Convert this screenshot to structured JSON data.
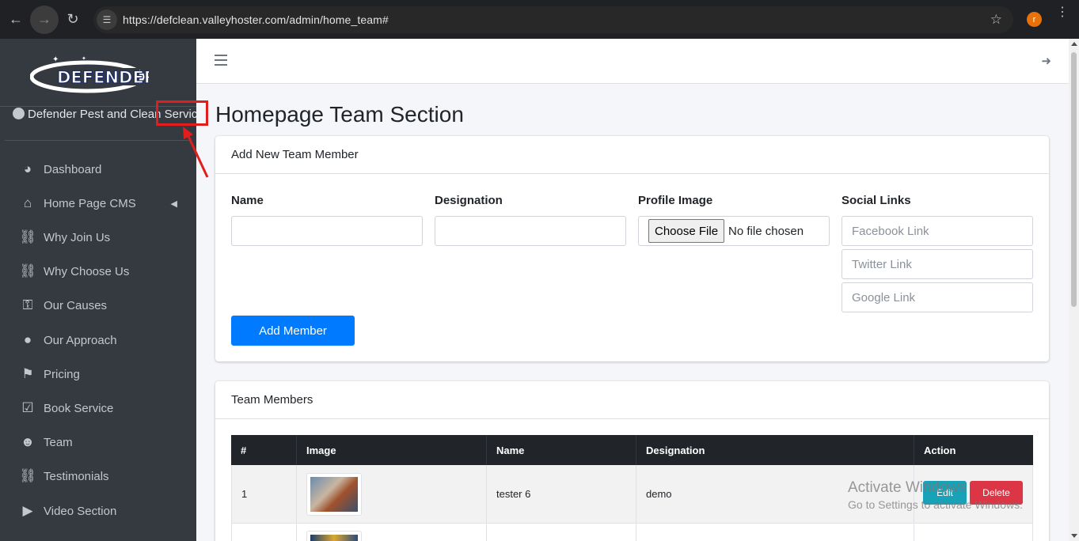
{
  "browser": {
    "url": "https://defclean.valleyhoster.com/admin/home_team#",
    "profile_initial": "r"
  },
  "sidebar": {
    "logo_text": "DEFENDER",
    "user_name": "Defender Pest and Clean Servic",
    "items": [
      {
        "label": "Dashboard",
        "icon": "tachometer-icon"
      },
      {
        "label": "Home Page CMS",
        "icon": "home-icon"
      },
      {
        "label": "Why Join Us",
        "icon": "comments-icon"
      },
      {
        "label": "Why Choose Us",
        "icon": "comments-icon"
      },
      {
        "label": "Our Causes",
        "icon": "key-icon"
      },
      {
        "label": "Our Approach",
        "icon": "lightbulb-icon"
      },
      {
        "label": "Pricing",
        "icon": "tags-icon"
      },
      {
        "label": "Book Service",
        "icon": "calendar-check-icon"
      },
      {
        "label": "Team",
        "icon": "users-icon"
      },
      {
        "label": "Testimonials",
        "icon": "comments-icon"
      },
      {
        "label": "Video Section",
        "icon": "play-circle-icon"
      }
    ]
  },
  "page": {
    "title": "Homepage Team Section"
  },
  "add_form": {
    "header": "Add New Team Member",
    "name_label": "Name",
    "designation_label": "Designation",
    "profile_image_label": "Profile Image",
    "social_links_label": "Social Links",
    "choose_file": "Choose File",
    "no_file": "No file chosen",
    "facebook_placeholder": "Facebook Link",
    "twitter_placeholder": "Twitter Link",
    "google_placeholder": "Google Link",
    "submit_label": "Add Member"
  },
  "team_table": {
    "header": "Team Members",
    "columns": [
      "#",
      "Image",
      "Name",
      "Designation",
      "Action"
    ],
    "rows": [
      {
        "num": "1",
        "name": "tester 6",
        "designation": "demo"
      }
    ],
    "edit_label": "Edit",
    "delete_label": "Delete"
  },
  "watermark": {
    "line1": "Activate Windows",
    "line2": "Go to Settings to activate Windows."
  },
  "colors": {
    "sidebar_bg": "#343a40",
    "primary": "#007bff",
    "info": "#17a2b8",
    "danger": "#dc3545",
    "annotation": "#e11d1d"
  }
}
